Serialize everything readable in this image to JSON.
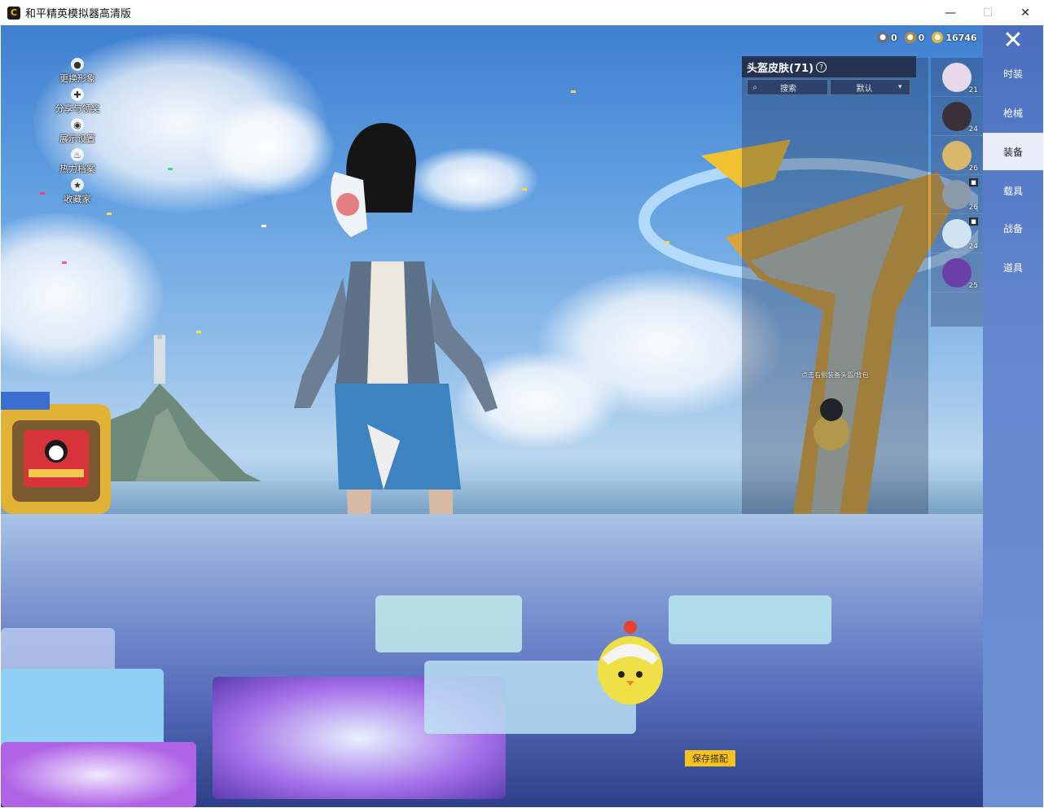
{
  "window": {
    "title": "和平精英模拟器高清版",
    "app_icon": "C",
    "minimize": "—",
    "maximize": "☐",
    "close": "✕"
  },
  "left_menu": [
    {
      "label": "更换形象",
      "icon": "avatar-icon",
      "glyph": "●"
    },
    {
      "label": "分享与领奖",
      "icon": "share-icon",
      "glyph": "✚"
    },
    {
      "label": "展示设置",
      "icon": "eye-icon",
      "glyph": "◉"
    },
    {
      "label": "热力档案",
      "icon": "flame-icon",
      "glyph": "♨"
    },
    {
      "label": "收藏家",
      "icon": "collector-badge-icon",
      "glyph": "★"
    }
  ],
  "currency": [
    {
      "icon": "coupon-icon",
      "value": "0",
      "color": "#6a6f7a"
    },
    {
      "icon": "badge-icon",
      "value": "0",
      "color": "#b08a3c"
    },
    {
      "icon": "gold-coin-icon",
      "value": "16746",
      "color": "#e0b53a"
    }
  ],
  "panel": {
    "title": "头盔皮肤(71)",
    "search_label": "搜索",
    "sort_label": "默认",
    "tip": "点击右侧装备头盔/背包"
  },
  "items": [
    {
      "count": "21",
      "color": "#e8d9ea",
      "locked": false
    },
    {
      "count": "24",
      "color": "#3a3036",
      "locked": false
    },
    {
      "count": "26",
      "color": "#d9b86b",
      "locked": false
    },
    {
      "count": "26",
      "color": "#8a9aa8",
      "locked": true
    },
    {
      "count": "24",
      "color": "#cfe3f0",
      "locked": true
    },
    {
      "count": "25",
      "color": "#6a3fa5",
      "locked": false
    }
  ],
  "tabs": [
    "时装",
    "枪械",
    "装备",
    "载具",
    "战备",
    "道具"
  ],
  "active_tab": "装备",
  "save_button": "保存搭配",
  "colors": {
    "accent_yellow": "#f4c31e",
    "tab_bar": "#5f82cc",
    "active_tab_bg": "#e9eef8"
  }
}
